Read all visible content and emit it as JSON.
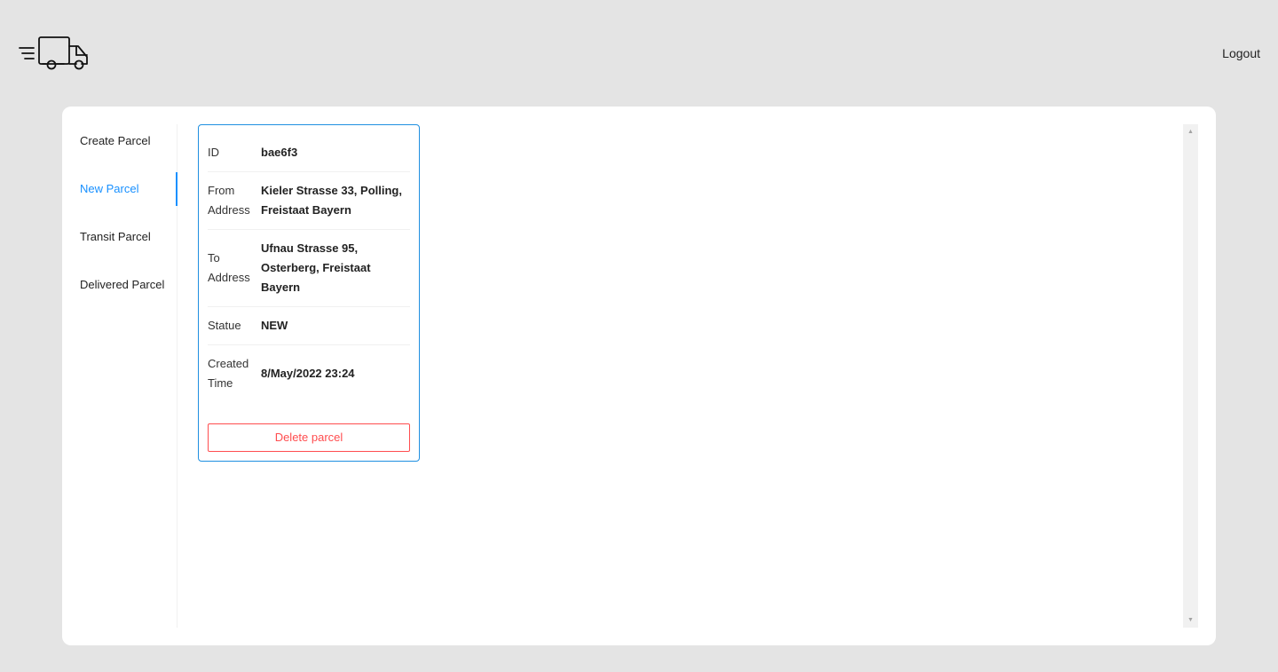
{
  "header": {
    "logo_icon": "delivery-truck-icon",
    "logout_label": "Logout"
  },
  "sidebar": {
    "items": [
      {
        "label": "Create Parcel",
        "active": false
      },
      {
        "label": "New Parcel",
        "active": true
      },
      {
        "label": "Transit Parcel",
        "active": false
      },
      {
        "label": "Delivered Parcel",
        "active": false
      }
    ],
    "accent_color": "#1890ff"
  },
  "parcel": {
    "id_label": "ID",
    "id_value": "bae6f3",
    "from_label": "From Address",
    "from_value": "Kieler Strasse 33, Polling, Freistaat Bayern",
    "to_label": "To Address",
    "to_value": "Ufnau Strasse 95, Osterberg, Freistaat Bayern",
    "status_label": "Statue",
    "status_value": "NEW",
    "created_label": "Created Time",
    "created_value": "8/May/2022 23:24",
    "delete_label": "Delete parcel",
    "delete_color": "#ff4d4f"
  },
  "scrollbar": {
    "up_icon": "scroll-up-arrow-icon",
    "down_icon": "scroll-down-arrow-icon"
  }
}
